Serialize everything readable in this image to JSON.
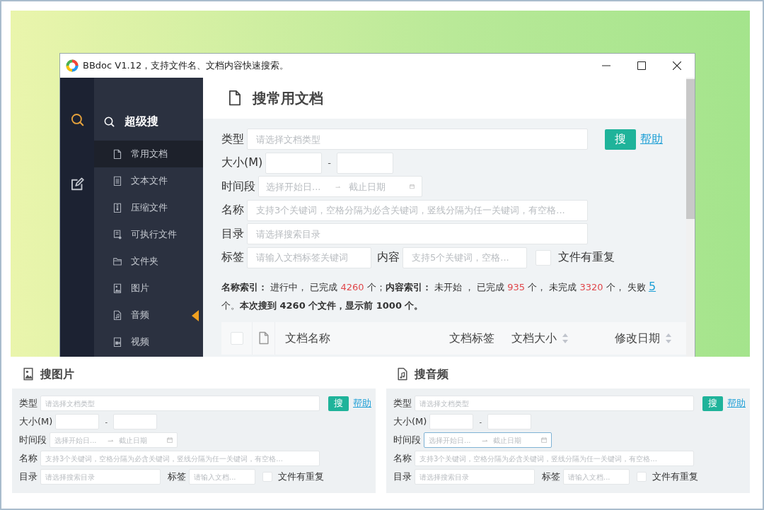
{
  "window": {
    "title": "BBdoc V1.12，支持文件名、文档内容快速搜索。"
  },
  "rail": [
    {
      "selected": true
    },
    {
      "selected": false
    }
  ],
  "sidebar": {
    "heading": "超级搜",
    "items": [
      {
        "label": "常用文档",
        "selected": true,
        "marked": false
      },
      {
        "label": "文本文件",
        "selected": false,
        "marked": false
      },
      {
        "label": "压缩文件",
        "selected": false,
        "marked": false
      },
      {
        "label": "可执行文件",
        "selected": false,
        "marked": false
      },
      {
        "label": "文件夹",
        "selected": false,
        "marked": false
      },
      {
        "label": "图片",
        "selected": false,
        "marked": false
      },
      {
        "label": "音频",
        "selected": false,
        "marked": true
      },
      {
        "label": "视频",
        "selected": false,
        "marked": false
      }
    ]
  },
  "main": {
    "title": "搜常用文档",
    "form": {
      "rows": [
        {
          "items": [
            {
              "kind": "label",
              "text": "类型"
            },
            {
              "kind": "input",
              "placeholder": "请选择文档类型"
            },
            {
              "kind": "button",
              "text": "搜"
            },
            {
              "kind": "link",
              "text": "帮助"
            }
          ]
        },
        {
          "items": [
            {
              "kind": "label",
              "text": "大小(M)"
            },
            {
              "kind": "input"
            },
            {
              "kind": "dash",
              "text": "-"
            },
            {
              "kind": "input"
            }
          ]
        },
        {
          "items": [
            {
              "kind": "label",
              "text": "时间段"
            },
            {
              "kind": "date",
              "start_placeholder": "选择开始日...",
              "end_placeholder": "截止日期",
              "focused": false
            }
          ]
        },
        {
          "items": [
            {
              "kind": "label",
              "text": "名称"
            },
            {
              "kind": "input",
              "placeholder": "支持3个关键词，空格分隔为必含关键词，竖线分隔为任一关键词，有空格..."
            }
          ]
        },
        {
          "items": [
            {
              "kind": "label",
              "text": "目录"
            },
            {
              "kind": "input",
              "placeholder": "请选择搜索目录"
            }
          ]
        },
        {
          "items": [
            {
              "kind": "label",
              "text": "标签"
            },
            {
              "kind": "input",
              "placeholder": "请输入文档标签关键词"
            },
            {
              "kind": "label",
              "text": "内容"
            },
            {
              "kind": "input",
              "placeholder": "支持5个关键词，空格..."
            },
            {
              "kind": "checkbox",
              "text": "文件有重复",
              "checked": false
            }
          ]
        }
      ]
    },
    "status": [
      {
        "kind": "bold",
        "text": "名称索引："
      },
      {
        "kind": "plain",
        "text": " 进行中， 已完成 "
      },
      {
        "kind": "number",
        "text": "4260"
      },
      {
        "kind": "plain",
        "text": " 个；"
      },
      {
        "kind": "bold",
        "text": "内容索引："
      },
      {
        "kind": "plain",
        "text": " 未开始 ， 已完成 "
      },
      {
        "kind": "number",
        "text": "935"
      },
      {
        "kind": "plain",
        "text": " 个， 未完成 "
      },
      {
        "kind": "number",
        "text": "3320"
      },
      {
        "kind": "plain",
        "text": " 个， 失败 "
      },
      {
        "kind": "link",
        "text": "5"
      },
      {
        "kind": "plain",
        "text": " 个。"
      },
      {
        "kind": "bold",
        "text": "本次搜到 4260 个文件，显示前 1000 个。"
      }
    ],
    "table": {
      "columns": [
        {
          "kind": "checkbox",
          "checked": false
        },
        {
          "kind": "icon"
        },
        {
          "kind": "text",
          "label": "文档名称",
          "sortable": false
        },
        {
          "kind": "text",
          "label": "文档标签",
          "sortable": false
        },
        {
          "kind": "text",
          "label": "文档大小",
          "sortable": true
        },
        {
          "kind": "text",
          "label": "修改日期",
          "sortable": true
        }
      ]
    }
  },
  "panels": [
    {
      "title": "搜图片",
      "form": {
        "rows": [
          {
            "items": [
              {
                "kind": "label",
                "text": "类型"
              },
              {
                "kind": "input",
                "placeholder": "请选择文档类型"
              },
              {
                "kind": "button",
                "text": "搜"
              },
              {
                "kind": "link",
                "text": "帮助"
              }
            ]
          },
          {
            "items": [
              {
                "kind": "label",
                "text": "大小(M)"
              },
              {
                "kind": "input"
              },
              {
                "kind": "dash",
                "text": "-"
              },
              {
                "kind": "input"
              }
            ]
          },
          {
            "items": [
              {
                "kind": "label",
                "text": "时间段"
              },
              {
                "kind": "date",
                "start_placeholder": "选择开始日...",
                "end_placeholder": "截止日期",
                "focused": false
              }
            ]
          },
          {
            "items": [
              {
                "kind": "label",
                "text": "名称"
              },
              {
                "kind": "input",
                "placeholder": "支持3个关键词，空格分隔为必含关键词，竖线分隔为任一关键词，有空格..."
              }
            ]
          },
          {
            "items": [
              {
                "kind": "label",
                "text": "目录"
              },
              {
                "kind": "input",
                "placeholder": "请选择搜索目录"
              },
              {
                "kind": "label",
                "text": "标签"
              },
              {
                "kind": "input",
                "placeholder": "请输入文档..."
              },
              {
                "kind": "checkbox",
                "text": "文件有重复",
                "checked": false
              }
            ]
          }
        ]
      }
    },
    {
      "title": "搜音频",
      "form": {
        "rows": [
          {
            "items": [
              {
                "kind": "label",
                "text": "类型"
              },
              {
                "kind": "input",
                "placeholder": "请选择文档类型"
              },
              {
                "kind": "button",
                "text": "搜"
              },
              {
                "kind": "link",
                "text": "帮助"
              }
            ]
          },
          {
            "items": [
              {
                "kind": "label",
                "text": "大小(M)"
              },
              {
                "kind": "input"
              },
              {
                "kind": "dash",
                "text": "-"
              },
              {
                "kind": "input"
              }
            ]
          },
          {
            "items": [
              {
                "kind": "label",
                "text": "时间段"
              },
              {
                "kind": "date",
                "start_placeholder": "选择开始日...",
                "end_placeholder": "截止日期",
                "focused": true
              }
            ]
          },
          {
            "items": [
              {
                "kind": "label",
                "text": "名称"
              },
              {
                "kind": "input",
                "placeholder": "支持3个关键词，空格分隔为必含关键词，竖线分隔为任一关键词，有空格..."
              }
            ]
          },
          {
            "items": [
              {
                "kind": "label",
                "text": "目录"
              },
              {
                "kind": "input",
                "placeholder": "请选择搜索目录"
              },
              {
                "kind": "label",
                "text": "标签"
              },
              {
                "kind": "input",
                "placeholder": "请输入文档..."
              },
              {
                "kind": "checkbox",
                "text": "文件有重复",
                "checked": false
              }
            ]
          }
        ]
      }
    }
  ]
}
